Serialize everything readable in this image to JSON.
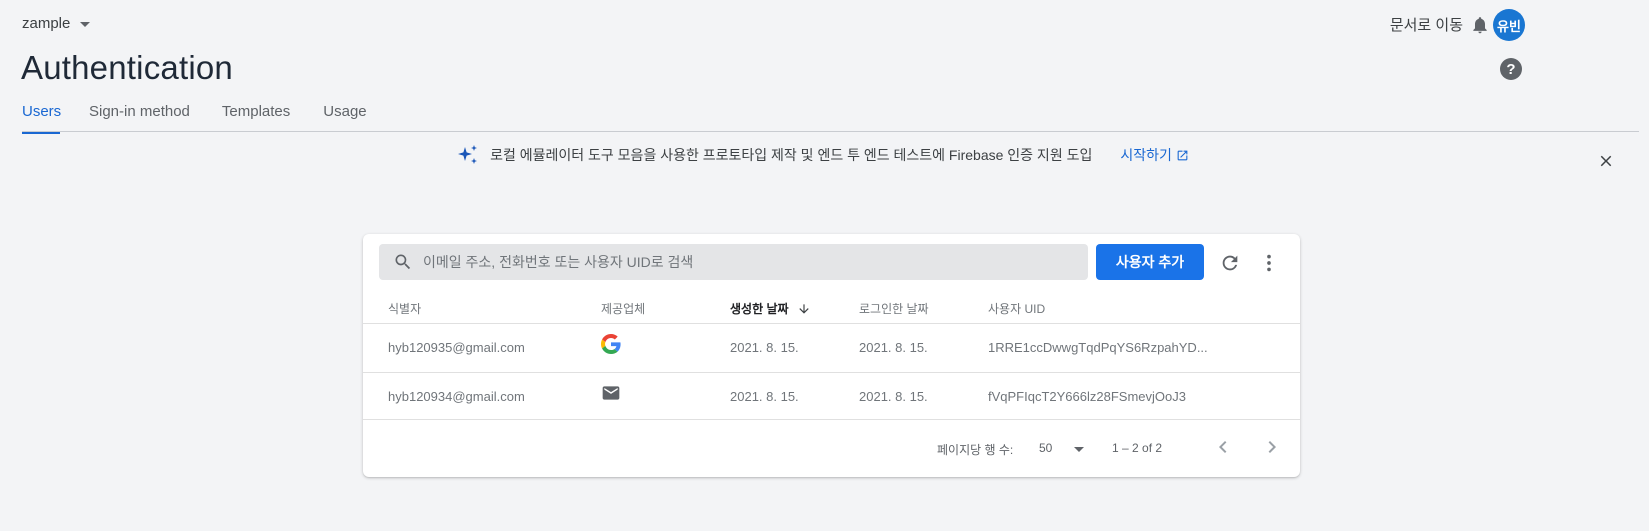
{
  "header": {
    "project_name": "zample",
    "docs_link": "문서로 이동",
    "avatar_initials": "유빈",
    "help_label": "?",
    "accent_color": "#1a73e8"
  },
  "page": {
    "title": "Authentication",
    "tabs": [
      {
        "label": "Users",
        "active": true
      },
      {
        "label": "Sign-in method",
        "active": false
      },
      {
        "label": "Templates",
        "active": false
      },
      {
        "label": "Usage",
        "active": false
      }
    ]
  },
  "banner": {
    "text": "로컬 에뮬레이터 도구 모음을 사용한 프로토타입 제작 및 엔드 투 엔드 테스트에 Firebase 인증 지원 도입",
    "cta": "시작하기",
    "icon": "sparkle-icon",
    "close_icon": "close-icon"
  },
  "users_table": {
    "search_placeholder": "이메일 주소, 전화번호 또는 사용자 UID로 검색",
    "add_user_label": "사용자 추가",
    "columns": [
      "식별자",
      "제공업체",
      "생성한 날짜",
      "로그인한 날짜",
      "사용자 UID"
    ],
    "sorted_column": "생성한 날짜",
    "sort_direction": "descending",
    "rows": [
      {
        "identifier": "hyb120935@gmail.com",
        "provider": "google-icon",
        "created": "2021. 8. 15.",
        "signed_in": "2021. 8. 15.",
        "uid": "1RRE1ccDwwgTqdPqYS6RzpahYD..."
      },
      {
        "identifier": "hyb120934@gmail.com",
        "provider": "email-icon",
        "created": "2021. 8. 15.",
        "signed_in": "2021. 8. 15.",
        "uid": "fVqPFIqcT2Y666lz28FSmevjOoJ3"
      }
    ],
    "pagination": {
      "rows_per_page_label": "페이지당 행 수:",
      "rows_per_page": "50",
      "range": "1 – 2 of 2"
    }
  }
}
